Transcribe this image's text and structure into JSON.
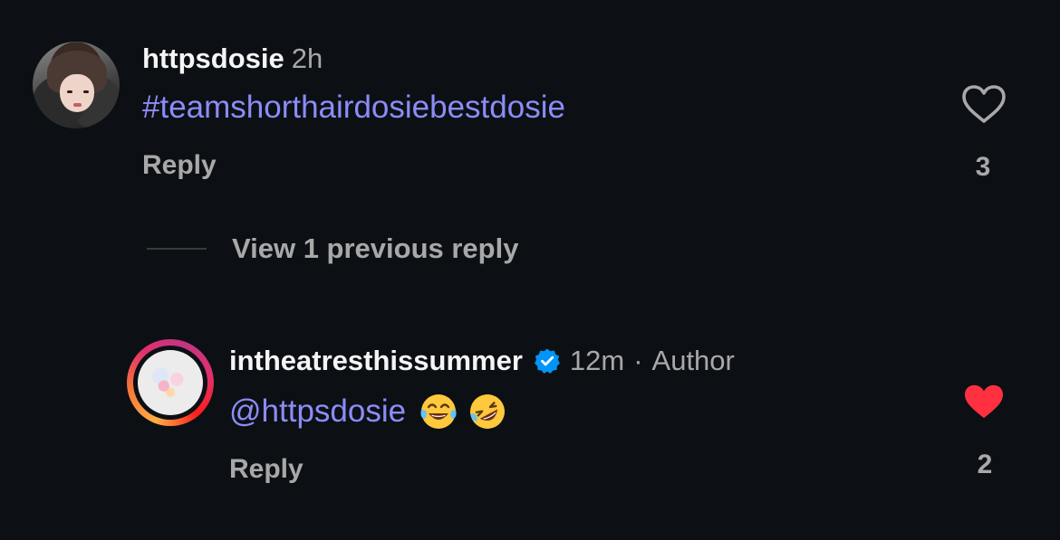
{
  "comments": [
    {
      "username": "httpsdosie",
      "time": "2h",
      "text": "#teamshorthairdosiebestdosie",
      "reply_label": "Reply",
      "likes": "3",
      "liked": false
    },
    {
      "username": "intheatresthissummer",
      "verified": true,
      "time": "12m",
      "separator": "·",
      "role": "Author",
      "mention": "@httpsdosie",
      "emojis": [
        "face-with-tears-of-joy",
        "rolling-on-the-floor-laughing"
      ],
      "reply_label": "Reply",
      "likes": "2",
      "liked": true
    }
  ],
  "view_replies": "View 1 previous reply",
  "colors": {
    "background": "#0c1014",
    "mention": "#8c8cf8",
    "muted": "#a8a8a8",
    "like": "#ff3040",
    "verified": "#0095f6"
  }
}
